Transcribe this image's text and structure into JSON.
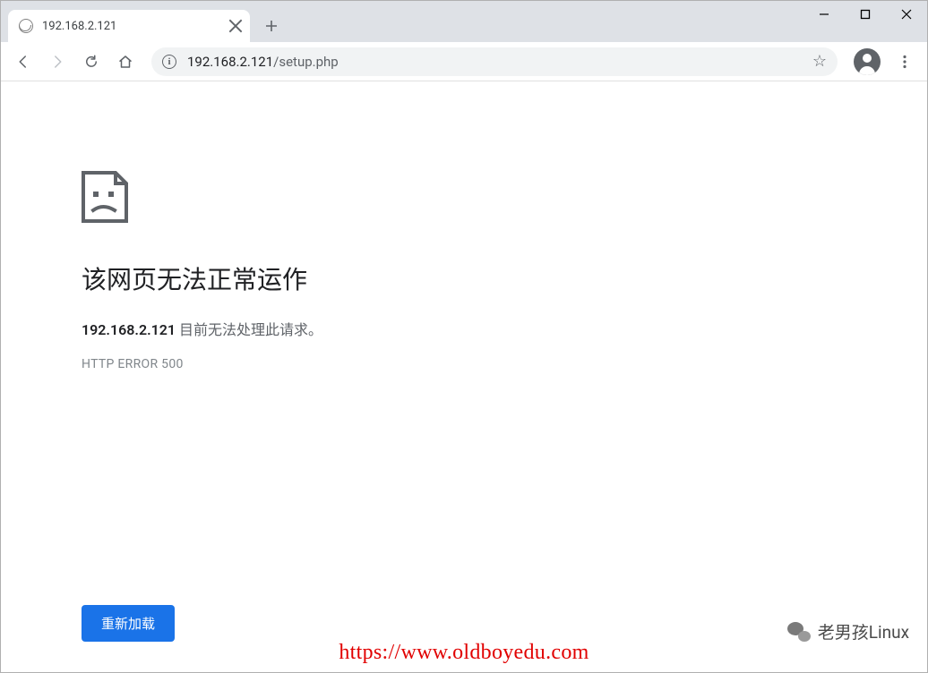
{
  "tab": {
    "title": "192.168.2.121"
  },
  "omnibox": {
    "host": "192.168.2.121",
    "path": "/setup.php"
  },
  "error": {
    "title": "该网页无法正常运作",
    "host": "192.168.2.121",
    "message": " 目前无法处理此请求。",
    "code": "HTTP ERROR 500",
    "reload_label": "重新加载"
  },
  "watermark": {
    "url": "https://www.oldboyedu.com",
    "brand": "老男孩Linux"
  }
}
